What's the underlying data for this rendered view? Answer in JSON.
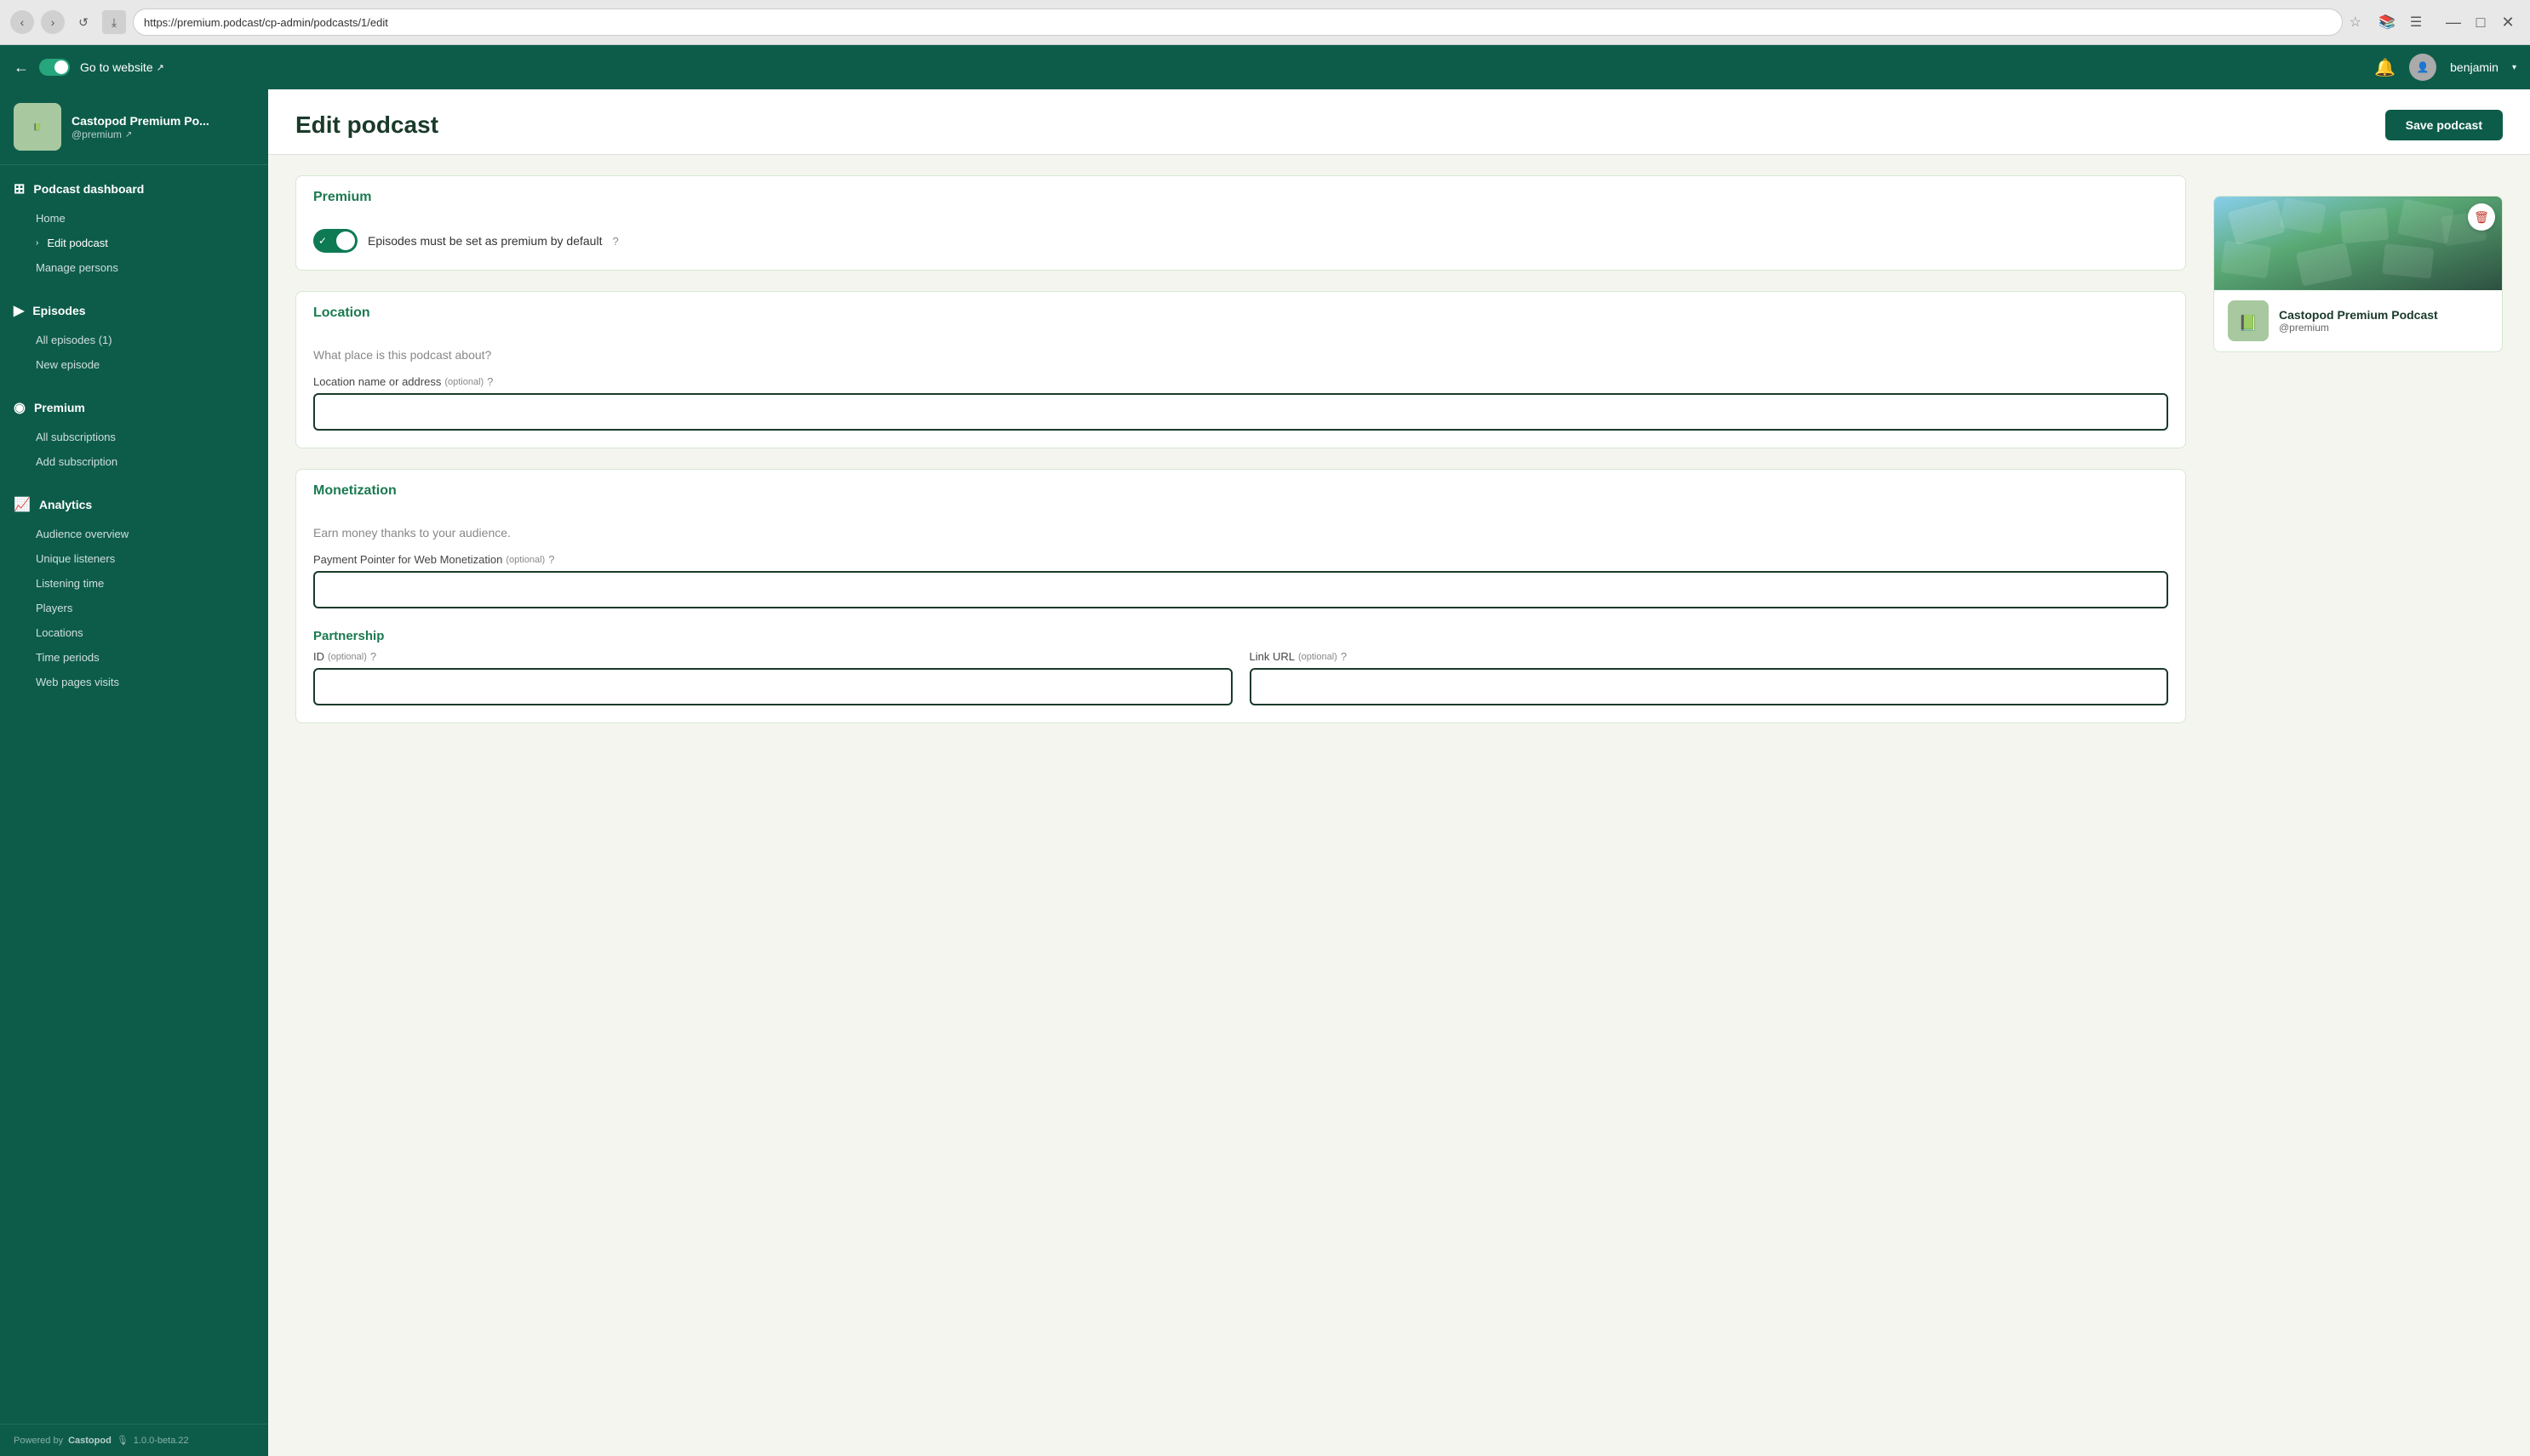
{
  "browser": {
    "url": "https://premium.podcast/cp-admin/podcasts/1/edit",
    "nav_back": "‹",
    "nav_forward": "›",
    "reload": "↺",
    "bookmark": "⤓",
    "star": "☆",
    "extensions_icon": "📚",
    "menu_icon": "☰",
    "minimize": "—",
    "maximize": "□",
    "close": "✕"
  },
  "topbar": {
    "go_to_website": "Go to website",
    "external_icon": "↗",
    "notification_icon": "🔔",
    "user_name": "benjamin",
    "dropdown_icon": "▾"
  },
  "sidebar": {
    "podcast_name": "Castopod Premium Po...",
    "podcast_handle": "@premium",
    "external_link_icon": "↗",
    "sections": [
      {
        "id": "dashboard",
        "icon": "⊞",
        "label": "Podcast dashboard",
        "items": [
          {
            "id": "home",
            "label": "Home"
          },
          {
            "id": "edit-podcast",
            "label": "Edit podcast",
            "active": true,
            "chevron": "›"
          },
          {
            "id": "manage-persons",
            "label": "Manage persons"
          }
        ]
      },
      {
        "id": "episodes",
        "icon": "▶",
        "label": "Episodes",
        "items": [
          {
            "id": "all-episodes",
            "label": "All episodes (1)"
          },
          {
            "id": "new-episode",
            "label": "New episode"
          }
        ]
      },
      {
        "id": "premium",
        "icon": "◉",
        "label": "Premium",
        "items": [
          {
            "id": "all-subscriptions",
            "label": "All subscriptions"
          },
          {
            "id": "add-subscription",
            "label": "Add subscription"
          }
        ]
      },
      {
        "id": "analytics",
        "icon": "📈",
        "label": "Analytics",
        "items": [
          {
            "id": "audience-overview",
            "label": "Audience overview"
          },
          {
            "id": "unique-listeners",
            "label": "Unique listeners"
          },
          {
            "id": "listening-time",
            "label": "Listening time"
          },
          {
            "id": "players",
            "label": "Players"
          },
          {
            "id": "locations",
            "label": "Locations"
          },
          {
            "id": "time-periods",
            "label": "Time periods"
          },
          {
            "id": "web-pages-visits",
            "label": "Web pages visits"
          }
        ]
      }
    ],
    "footer": {
      "powered_by": "Powered by",
      "brand": "Castopod",
      "icon": "🎙",
      "version": "1.0.0-beta.22"
    }
  },
  "page": {
    "title": "Edit podcast",
    "save_button": "Save podcast"
  },
  "podcast_card": {
    "name": "Castopod Premium Podcast",
    "handle": "@premium",
    "delete_icon": "🗑"
  },
  "sections": {
    "premium": {
      "title": "Premium",
      "toggle_label": "Episodes must be set as premium by default",
      "toggle_enabled": true,
      "help_icon": "?"
    },
    "location": {
      "title": "Location",
      "description": "What place is this podcast about?",
      "location_label": "Location name or address",
      "optional_tag": "(optional)",
      "help_icon": "?",
      "location_value": "",
      "location_placeholder": ""
    },
    "monetization": {
      "title": "Monetization",
      "description": "Earn money thanks to your audience.",
      "payment_label": "Payment Pointer for Web Monetization",
      "optional_tag": "(optional)",
      "help_icon": "?",
      "payment_value": "",
      "payment_placeholder": ""
    },
    "partnership": {
      "title": "Partnership",
      "id_label": "ID",
      "optional_tag": "(optional)",
      "id_help_icon": "?",
      "link_url_label": "Link URL",
      "link_url_optional": "(optional)",
      "link_url_help_icon": "?"
    }
  }
}
